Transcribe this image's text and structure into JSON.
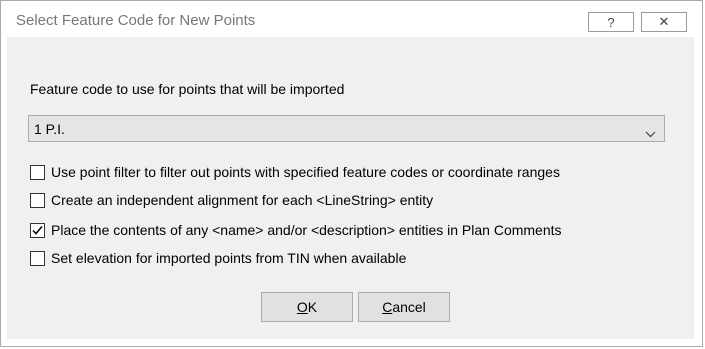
{
  "window": {
    "title": "Select Feature Code for New Points",
    "help_glyph": "?",
    "close_glyph": "✕"
  },
  "feature_code": {
    "label": "Feature code to use for points that will be imported",
    "selected": "1 P.I."
  },
  "options": [
    {
      "label": "Use point filter to filter out points with specified feature codes or coordinate ranges",
      "checked": false
    },
    {
      "label": "Create an independent alignment for each <LineString> entity",
      "checked": false
    },
    {
      "label": "Place the contents of any <name> and/or <description> entities in Plan Comments",
      "checked": true
    },
    {
      "label": "Set elevation for imported points from TIN when available",
      "checked": false
    }
  ],
  "buttons": {
    "ok": {
      "mnemonic": "O",
      "rest": "K"
    },
    "cancel": {
      "mnemonic": "C",
      "rest": "ancel"
    }
  }
}
